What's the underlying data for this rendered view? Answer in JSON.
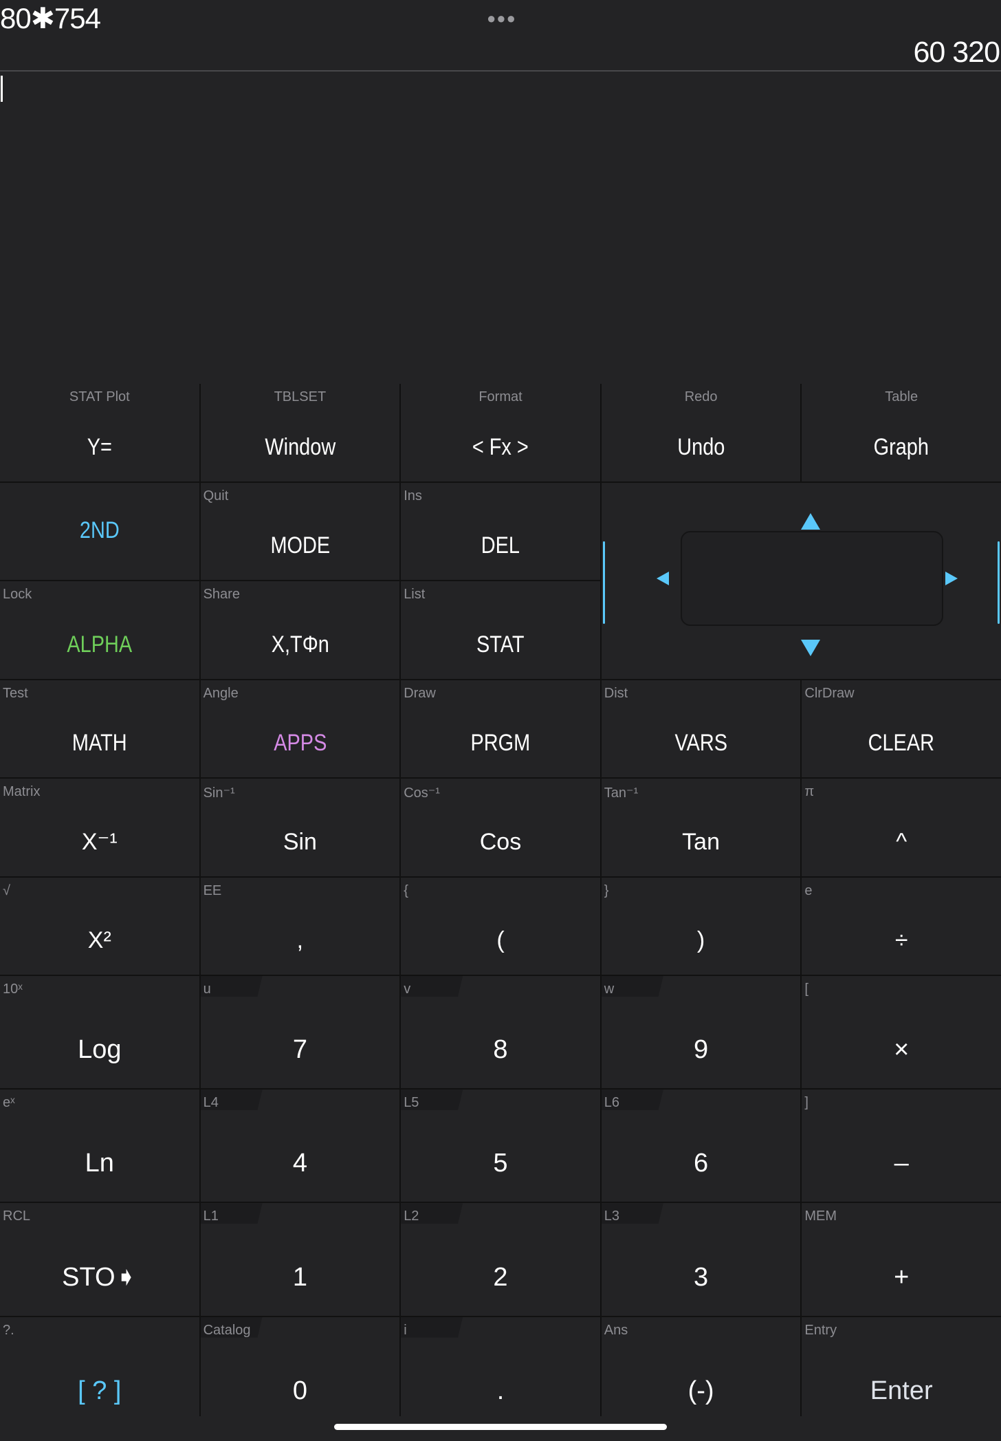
{
  "display": {
    "expression": "80✱754",
    "menu_icon": "more-dots-icon",
    "result": "60 320"
  },
  "colors": {
    "accent_blue": "#5ac8fa",
    "alpha_green": "#6fcf5a",
    "apps_purple": "#d58ae6",
    "secondary_gray": "#8d8d92"
  },
  "keys": [
    {
      "sec": "STAT Plot",
      "main": "Y="
    },
    {
      "sec": "TBLSET",
      "main": "Window"
    },
    {
      "sec": "Format",
      "main": "< Fx >"
    },
    {
      "sec": "Redo",
      "main": "Undo"
    },
    {
      "sec": "Table",
      "main": "Graph"
    },
    {
      "sec": "",
      "main": "2ND"
    },
    {
      "sec": "Quit",
      "main": "MODE"
    },
    {
      "sec": "Ins",
      "main": "DEL"
    },
    {
      "sec": "Lock",
      "main": "ALPHA"
    },
    {
      "sec": "Share",
      "main": "X,TΦn"
    },
    {
      "sec": "List",
      "main": "STAT"
    },
    {
      "sec": "Test",
      "main": "MATH"
    },
    {
      "sec": "Angle",
      "main": "APPS"
    },
    {
      "sec": "Draw",
      "main": "PRGM"
    },
    {
      "sec": "Dist",
      "main": "VARS"
    },
    {
      "sec": "ClrDraw",
      "main": "CLEAR"
    },
    {
      "sec": "Matrix",
      "main": "X⁻¹"
    },
    {
      "sec": "Sin⁻¹",
      "main": "Sin"
    },
    {
      "sec": "Cos⁻¹",
      "main": "Cos"
    },
    {
      "sec": "Tan⁻¹",
      "main": "Tan"
    },
    {
      "sec": "π",
      "main": "^"
    },
    {
      "sec": "√",
      "main": "X²"
    },
    {
      "sec": "EE",
      "main": ","
    },
    {
      "sec": "{",
      "main": "("
    },
    {
      "sec": "}",
      "main": ")"
    },
    {
      "sec": "e",
      "main": "÷"
    },
    {
      "sec": "10ˣ",
      "main": "Log"
    },
    {
      "sec": "u",
      "main": "7"
    },
    {
      "sec": "v",
      "main": "8"
    },
    {
      "sec": "w",
      "main": "9"
    },
    {
      "sec": "[",
      "main": "×"
    },
    {
      "sec": "eˣ",
      "main": "Ln"
    },
    {
      "sec": "L4",
      "main": "4"
    },
    {
      "sec": "L5",
      "main": "5"
    },
    {
      "sec": "L6",
      "main": "6"
    },
    {
      "sec": "]",
      "main": "–"
    },
    {
      "sec": "RCL",
      "main": "STO➧"
    },
    {
      "sec": "L1",
      "main": "1"
    },
    {
      "sec": "L2",
      "main": "2"
    },
    {
      "sec": "L3",
      "main": "3"
    },
    {
      "sec": "MEM",
      "main": "+"
    },
    {
      "sec": "?.",
      "main": "[ ? ]"
    },
    {
      "sec": "Catalog",
      "main": "0"
    },
    {
      "sec": "i",
      "main": "."
    },
    {
      "sec": "Ans",
      "main": "(-)"
    },
    {
      "sec": "Entry",
      "main": "Enter"
    }
  ]
}
